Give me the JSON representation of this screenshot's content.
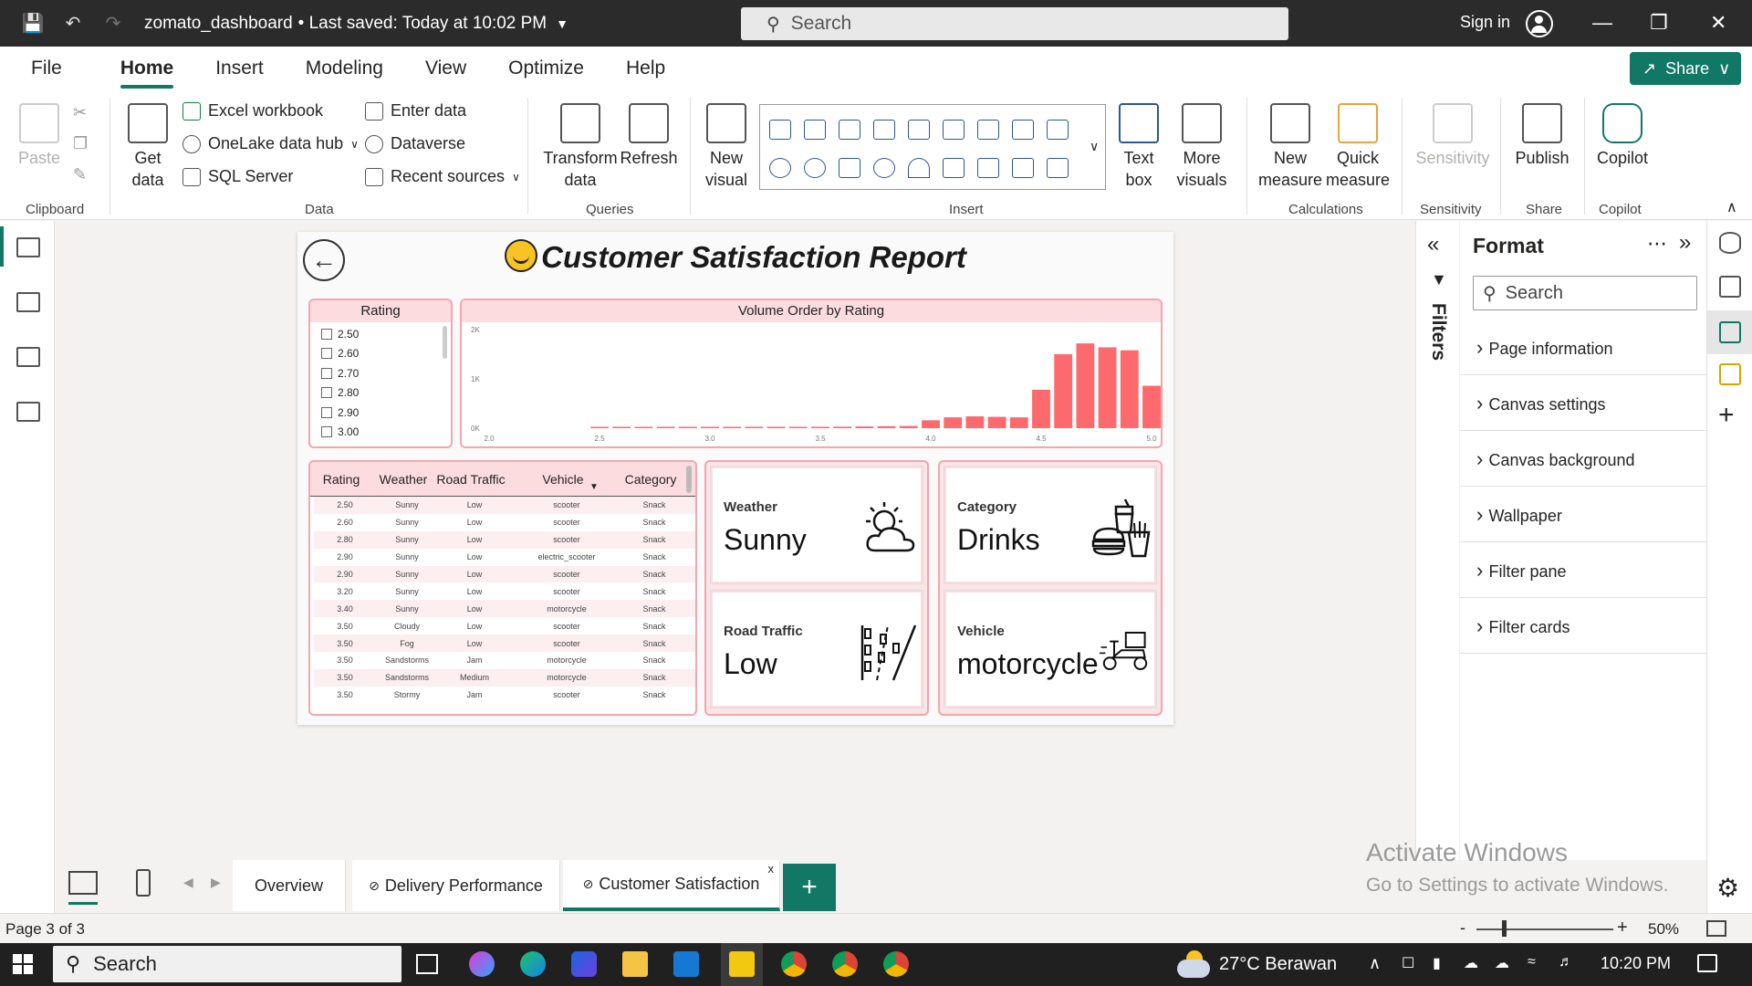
{
  "titlebar": {
    "filename": "zomato_dashboard",
    "saved_status": "• Last saved: Today at 10:02 PM",
    "search_placeholder": "Search",
    "sign_in": "Sign in"
  },
  "menu": {
    "tabs": [
      "File",
      "Home",
      "Insert",
      "Modeling",
      "View",
      "Optimize",
      "Help"
    ],
    "active_tab": "Home",
    "share_label": "Share"
  },
  "ribbon": {
    "clipboard": {
      "paste": "Paste",
      "group": "Clipboard"
    },
    "data": {
      "get_data": "Get",
      "get_data_2": "data",
      "excel": "Excel workbook",
      "onelake": "OneLake data hub",
      "sql": "SQL Server",
      "enter_data": "Enter data",
      "dataverse": "Dataverse",
      "recent": "Recent sources",
      "group": "Data"
    },
    "queries": {
      "transform": "Transform",
      "transform_2": "data",
      "refresh": "Refresh",
      "group": "Queries"
    },
    "insert": {
      "new_visual": "New",
      "new_visual_2": "visual",
      "text_box": "Text",
      "text_box_2": "box",
      "more_visuals": "More",
      "more_visuals_2": "visuals",
      "group": "Insert"
    },
    "calculations": {
      "new_measure": "New",
      "new_measure_2": "measure",
      "quick_measure": "Quick",
      "quick_measure_2": "measure",
      "group": "Calculations"
    },
    "sensitivity": {
      "label": "Sensitivity",
      "group": "Sensitivity"
    },
    "share": {
      "publish": "Publish",
      "group": "Share"
    },
    "copilot": {
      "label": "Copilot",
      "group": "Copilot"
    }
  },
  "report": {
    "title": "Customer Satisfaction Report",
    "slicer": {
      "header": "Rating",
      "items": [
        "2.50",
        "2.60",
        "2.70",
        "2.80",
        "2.90",
        "3.00"
      ]
    },
    "chart_header": "Volume Order by Rating",
    "table": {
      "columns": [
        "Rating",
        "Weather",
        "Road Traffic",
        "Vehicle",
        "Category"
      ],
      "rows": [
        [
          "2.50",
          "Sunny",
          "Low",
          "scooter",
          "Snack"
        ],
        [
          "2.60",
          "Sunny",
          "Low",
          "scooter",
          "Snack"
        ],
        [
          "2.80",
          "Sunny",
          "Low",
          "scooter",
          "Snack"
        ],
        [
          "2.90",
          "Sunny",
          "Low",
          "electric_scooter",
          "Snack"
        ],
        [
          "2.90",
          "Sunny",
          "Low",
          "scooter",
          "Snack"
        ],
        [
          "3.20",
          "Sunny",
          "Low",
          "scooter",
          "Snack"
        ],
        [
          "3.40",
          "Sunny",
          "Low",
          "motorcycle",
          "Snack"
        ],
        [
          "3.50",
          "Cloudy",
          "Low",
          "scooter",
          "Snack"
        ],
        [
          "3.50",
          "Fog",
          "Low",
          "scooter",
          "Snack"
        ],
        [
          "3.50",
          "Sandstorms",
          "Jam",
          "motorcycle",
          "Snack"
        ],
        [
          "3.50",
          "Sandstorms",
          "Medium",
          "motorcycle",
          "Snack"
        ],
        [
          "3.50",
          "Stormy",
          "Jam",
          "scooter",
          "Snack"
        ]
      ]
    },
    "cards": {
      "weather": {
        "label": "Weather",
        "value": "Sunny",
        "icon": "sun-cloud-icon"
      },
      "category": {
        "label": "Category",
        "value": "Drinks",
        "icon": "fast-food-icon"
      },
      "road_traffic": {
        "label": "Road Traffic",
        "value": "Low",
        "icon": "traffic-road-icon"
      },
      "vehicle": {
        "label": "Vehicle",
        "value": "motorcycle",
        "icon": "delivery-scooter-icon"
      }
    }
  },
  "chart_data": {
    "type": "bar",
    "title": "Volume Order by Rating",
    "x_ticks": [
      "2.0",
      "2.5",
      "3.0",
      "3.5",
      "4.0",
      "4.5",
      "5.0"
    ],
    "y_ticks": [
      "0K",
      "1K",
      "2K"
    ],
    "ylim": [
      0,
      2000
    ],
    "xlim": [
      2.0,
      5.0
    ],
    "color": "#fd6a6e",
    "x": [
      2.5,
      2.6,
      2.7,
      2.8,
      2.9,
      3.0,
      3.1,
      3.2,
      3.3,
      3.4,
      3.5,
      3.6,
      3.7,
      3.8,
      3.9,
      4.0,
      4.1,
      4.2,
      4.3,
      4.4,
      4.5,
      4.6,
      4.7,
      4.8,
      4.9,
      5.0
    ],
    "values": [
      10,
      12,
      10,
      12,
      10,
      12,
      14,
      15,
      15,
      16,
      25,
      30,
      35,
      40,
      45,
      160,
      220,
      240,
      230,
      220,
      780,
      1500,
      1720,
      1640,
      1580,
      860
    ]
  },
  "format_pane": {
    "title": "Format",
    "search_placeholder": "Search",
    "sections": [
      "Page information",
      "Canvas settings",
      "Canvas background",
      "Wallpaper",
      "Filter pane",
      "Filter cards"
    ]
  },
  "filters_label": "Filters",
  "pages": {
    "tabs": [
      "Overview",
      "Delivery Performance",
      "Customer Satisfaction"
    ],
    "active": "Customer Satisfaction",
    "add": "+"
  },
  "status": {
    "page": "Page 3 of 3",
    "zoom": "50%"
  },
  "watermark": {
    "line1": "Activate Windows",
    "line2": "Go to Settings to activate Windows."
  },
  "taskbar": {
    "search": "Search",
    "weather": "27°C  Berawan",
    "time": "10:20 PM"
  },
  "colors": {
    "accent": "#117865",
    "bar": "#fd6a6e",
    "panel_header": "#fcdcdf",
    "panel_border": "#f3a6ae"
  }
}
